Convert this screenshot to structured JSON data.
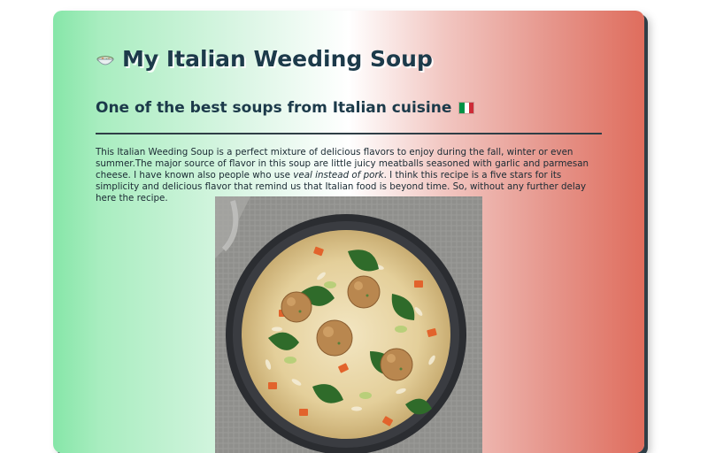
{
  "header": {
    "title": "My Italian Weeding Soup",
    "subtitle": "One of the best soups from Italian cuisine",
    "title_icon": "soup-bowl-icon",
    "subtitle_icon": "italian-flag-icon"
  },
  "intro": {
    "part1": "This Italian Weeding Soup is a perfect mixture of delicious flavors to enjoy during the fall, winter or even summer.The major source of flavor in this soup are little juicy meatballs seasoned with garlic and parmesan cheese. I have known also people who use ",
    "emphasis": "veal instead of pork",
    "part2": ". I think this recipe is a five stars for its simplicity and delicious flavor that remind us that Italian food is beyond time. So, without any further delay here the recipe."
  },
  "colors": {
    "gradient_left": "#86e6a8",
    "gradient_right": "#df6d5d",
    "heading": "#1c3a4a",
    "flag_green": "#009246",
    "flag_white": "#ffffff",
    "flag_red": "#ce2b37"
  },
  "image": {
    "subject": "soup-photo"
  }
}
